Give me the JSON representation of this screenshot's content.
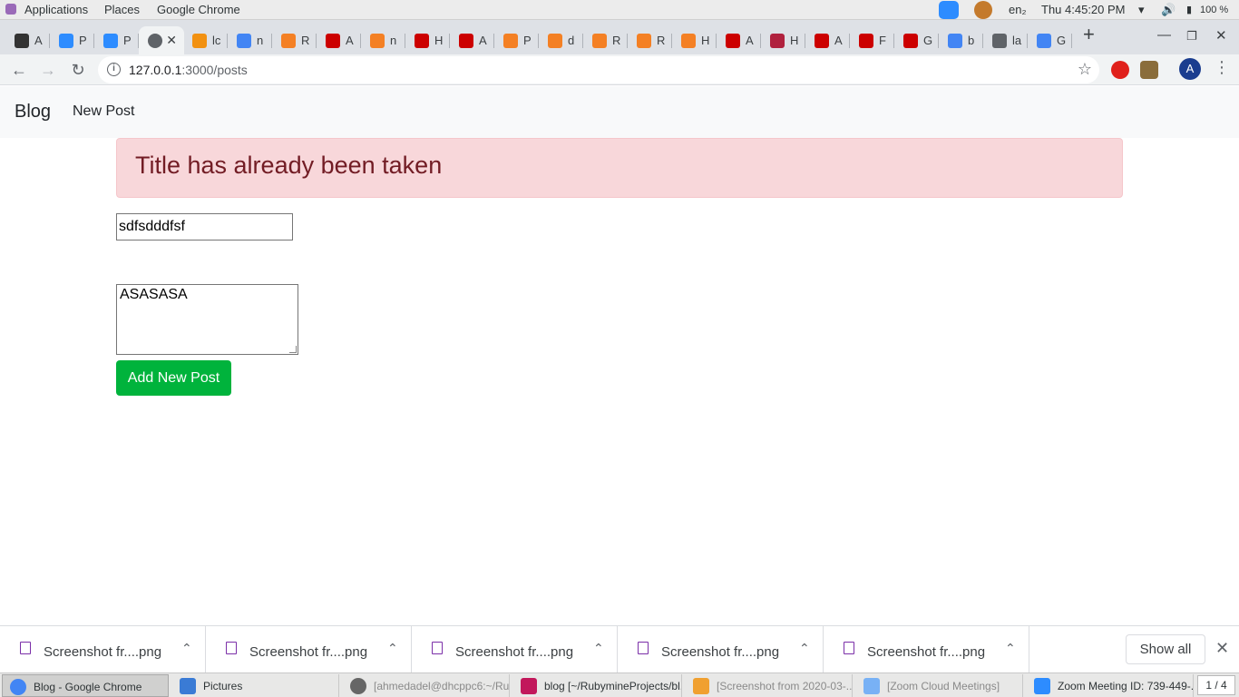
{
  "topbar": {
    "applications": "Applications",
    "places": "Places",
    "active_app": "Google Chrome",
    "keyboard": "en₂",
    "clock": "Thu  4:45:20 PM",
    "battery": "100 %"
  },
  "browser": {
    "active_tab_close": "✕",
    "new_tab": "+",
    "tabs": [
      {
        "label": "A",
        "color": "#333333"
      },
      {
        "label": "P",
        "color": "#2d8cff"
      },
      {
        "label": "P",
        "color": "#2d8cff"
      },
      {
        "label": "",
        "color": "#5f6368"
      },
      {
        "label": "lc",
        "color": "#f29111"
      },
      {
        "label": "n",
        "color": "#4285f4"
      },
      {
        "label": "R",
        "color": "#f48024"
      },
      {
        "label": "A",
        "color": "#cc0000"
      },
      {
        "label": "n",
        "color": "#f48024"
      },
      {
        "label": "H",
        "color": "#cc0000"
      },
      {
        "label": "A",
        "color": "#cc0000"
      },
      {
        "label": "P",
        "color": "#f48024"
      },
      {
        "label": "d",
        "color": "#f48024"
      },
      {
        "label": "R",
        "color": "#f48024"
      },
      {
        "label": "R",
        "color": "#f48024"
      },
      {
        "label": "H",
        "color": "#f48024"
      },
      {
        "label": "A",
        "color": "#cc0000"
      },
      {
        "label": "H",
        "color": "#b0213e"
      },
      {
        "label": "A",
        "color": "#cc0000"
      },
      {
        "label": "F",
        "color": "#cc0000"
      },
      {
        "label": "G",
        "color": "#cc0000"
      },
      {
        "label": "b",
        "color": "#4285f4"
      },
      {
        "label": "la",
        "color": "#5f6368"
      },
      {
        "label": "G",
        "color": "#4285f4"
      }
    ],
    "url_host": "127.0.0.1",
    "url_path": ":3000/posts",
    "profile_initial": "A"
  },
  "page": {
    "brand": "Blog",
    "nav_new_post": "New Post",
    "alert": "Title has already been taken",
    "title_value": "sdfsdddfsf",
    "body_value": "ASASASA",
    "submit_label": "Add New Post"
  },
  "downloads": {
    "items": [
      {
        "name": "Screenshot fr....png"
      },
      {
        "name": "Screenshot fr....png"
      },
      {
        "name": "Screenshot fr....png"
      },
      {
        "name": "Screenshot fr....png"
      },
      {
        "name": "Screenshot fr....png"
      }
    ],
    "show_all": "Show all"
  },
  "taskbar": {
    "items": [
      {
        "label": "Blog - Google Chrome",
        "color": "#4285f4"
      },
      {
        "label": "Pictures",
        "color": "#3a7bd5"
      },
      {
        "label": "[ahmedadel@dhcppc6:~/Ru...",
        "color": "#555555"
      },
      {
        "label": "blog [~/RubymineProjects/bl...",
        "color": "#c2185b"
      },
      {
        "label": "[Screenshot from 2020-03-...",
        "color": "#f0a030"
      },
      {
        "label": "[Zoom Cloud Meetings]",
        "color": "#2d8cff"
      },
      {
        "label": "Zoom Meeting ID: 739-449-...",
        "color": "#2d8cff"
      }
    ],
    "workspace": "1 / 4"
  },
  "colors": {
    "alert_bg": "#f8d7da",
    "alert_text": "#721c24",
    "submit_bg": "#00b33c"
  }
}
